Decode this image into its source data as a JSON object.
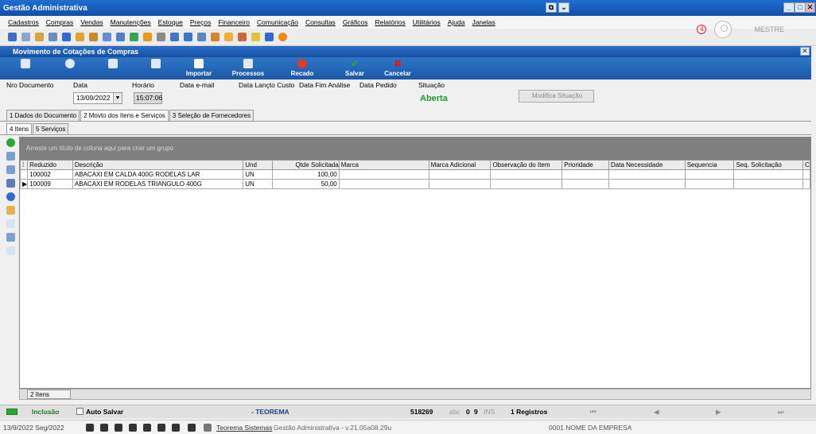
{
  "window": {
    "title": "Gestão Administrativa",
    "restore": "⧉",
    "chevron": "⌄",
    "minimize": "_",
    "maximize": "□",
    "close": "✕"
  },
  "menu": [
    "Cadastros",
    "Compras",
    "Vendas",
    "Manutenções",
    "Estoque",
    "Preços",
    "Financeiro",
    "Comunicação",
    "Consultas",
    "Gráficos",
    "Relatórios",
    "Utilitários",
    "Ajuda",
    "Janelas"
  ],
  "user": {
    "badge": "4",
    "name": "MESTRE"
  },
  "child_window": {
    "title": "Movimento de Cotações de Compras",
    "close": "✕"
  },
  "ribbon": {
    "importar": "Importar",
    "processos": "Processos",
    "recado": "Recado",
    "salvar": "Salvar",
    "cancelar": "Cancelar",
    "colors": {
      "recado": "#e03a2a",
      "salvar": "#27a830",
      "cancelar": "#d91c1c"
    }
  },
  "header": {
    "nro_documento": "Nro Documento",
    "data": "Data",
    "horario": "Horário",
    "data_email": "Data e-mail",
    "data_lancto": "Data Lançto Custo",
    "data_fim": "Data Fim Análise",
    "data_pedido": "Data Pedido",
    "situacao": "Situação",
    "date_value": "13/09/2022",
    "time_value": "15:07:06",
    "status_value": "Aberta",
    "modify_button": "Modifica Situação"
  },
  "tabs": [
    "1 Dados do Documento",
    "2 Movto dos Itens e Serviços",
    "3 Seleção de Fornecedores"
  ],
  "subtabs": [
    "4 Itens",
    "5 Serviços"
  ],
  "grid": {
    "group_hint": "Arraste um título de coluna aqui para criar um grupo",
    "columns": [
      "Reduzido",
      "Descrição",
      "Und",
      "Qtde Solicitada",
      "Marca",
      "Marca Adicional",
      "Observação do Item",
      "Prioridade",
      "Data Necessidade",
      "Sequencia",
      "Seq. Solicitação",
      "C"
    ],
    "rows": [
      [
        "100002",
        "ABACAXI EM CALDA 400G RODELAS LAR",
        "UN",
        "100,00",
        "",
        "",
        "",
        "",
        "",
        "",
        "",
        ""
      ],
      [
        "100009",
        "ABACAXI EM RODELAS TRIANGULO 400G",
        "UN",
        "50,00",
        "",
        "",
        "",
        "",
        "",
        "",
        "",
        ""
      ]
    ],
    "footer_count": "2 Itens"
  },
  "statusbar": {
    "mode": "Inclusão",
    "auto_save": "Auto Salvar",
    "company": "- TEOREMA",
    "code": "518269",
    "abc": "abc",
    "zero": "0",
    "nine": "9",
    "ins": "INS",
    "records": "1 Registros",
    "nav_first": "⏮",
    "nav_prev": "◀",
    "nav_next": "▶",
    "nav_last": "⏭"
  },
  "bottombar": {
    "date": "13/9/2022 Seg/2022",
    "vendor": "Teorema Sistemas",
    "version": "Gestão Administrativa - v.21.05a08.29u",
    "empresa": "0001 NOME DA EMPRESA"
  }
}
